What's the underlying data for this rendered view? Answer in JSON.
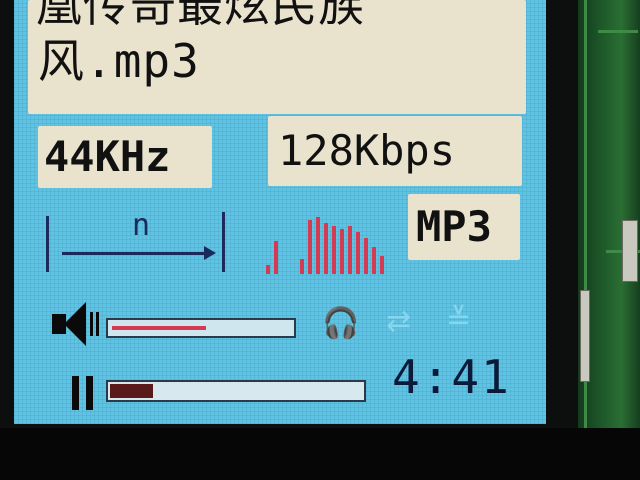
{
  "player": {
    "title_line1": "凰传奇最炫民族",
    "title_line2": "风.mp3",
    "sample_rate": "44KHz",
    "bitrate": "128Kbps",
    "format": "MP3",
    "mode_label": "n",
    "time": "4:41",
    "volume_fraction": 0.53,
    "progress_fraction": 0.17,
    "eq_levels": [
      0.15,
      0.55,
      0.25,
      0.9,
      0.95,
      0.85,
      0.8,
      0.75,
      0.8,
      0.7,
      0.6,
      0.45,
      0.3
    ],
    "accent_color": "#d43a52",
    "screen_color": "#5fc3e4",
    "icons": [
      "speaker-icon",
      "pause-icon",
      "headphones-icon",
      "repeat-icon",
      "eq-mode-icon"
    ]
  }
}
